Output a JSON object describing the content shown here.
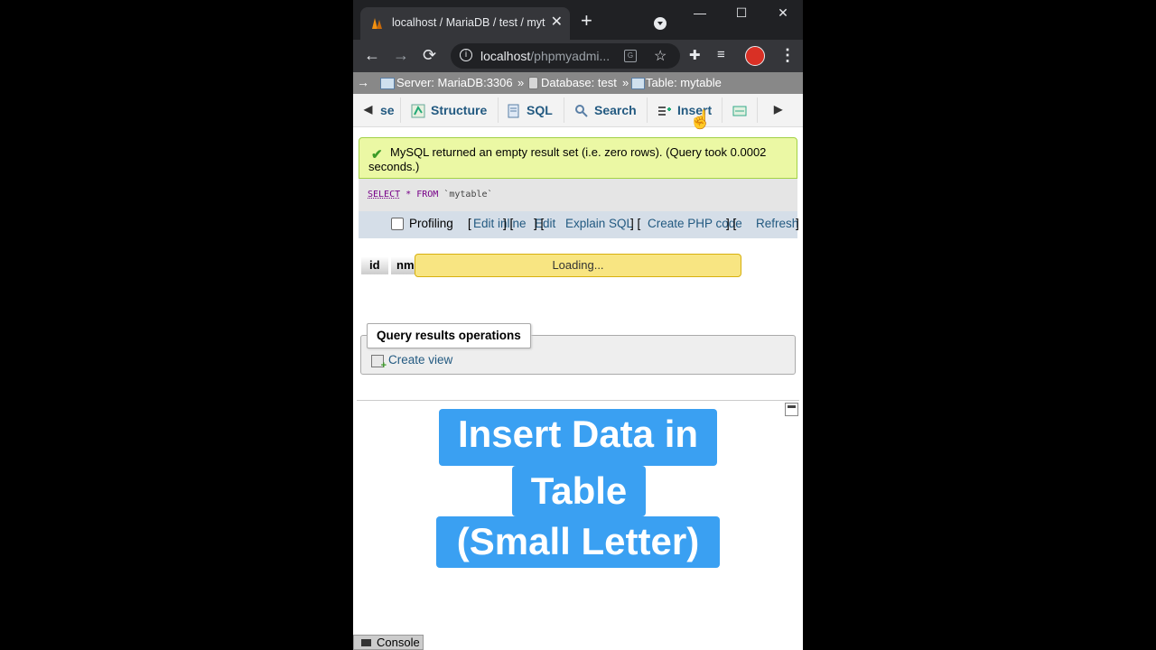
{
  "browser": {
    "tab_title": "localhost / MariaDB / test / myt",
    "tab_close": "✕",
    "new_tab": "+",
    "window": {
      "minimize": "—",
      "maximize": "☐",
      "close": "✕"
    },
    "url_host": "localhost",
    "url_path": "/phpmyadmi...",
    "nav": {
      "back": "←",
      "forward": "→",
      "reload": "⟳"
    },
    "icons": [
      "info-icon",
      "translate-icon",
      "star-icon",
      "extensions-icon",
      "media-icon",
      "profile-avatar",
      "menu-icon"
    ]
  },
  "breadcrumb": {
    "arrow": "→",
    "server": "Server: MariaDB:3306",
    "sep": "»",
    "database": "Database: test",
    "table": "Table: mytable"
  },
  "tabs": [
    {
      "label": "se"
    },
    {
      "label": "Structure"
    },
    {
      "label": "SQL"
    },
    {
      "label": "Search"
    },
    {
      "label": "Insert"
    },
    {
      "label": ""
    }
  ],
  "message": {
    "text": "MySQL returned an empty result set (i.e. zero rows). (Query took 0.0002 seconds.)",
    "sql_keyword": "SELECT",
    "sql_star": "*",
    "sql_from": "FROM",
    "sql_table": "`mytable`"
  },
  "query_links": {
    "profiling": "Profiling",
    "edit_inline": "Edit inline",
    "edit": "Edit",
    "explain": "Explain SQL",
    "php": "Create PHP code",
    "refresh": "Refresh",
    "open": "[",
    "close": "]",
    "between": "] ["
  },
  "results": {
    "columns": [
      "id",
      "nm"
    ],
    "loading": "Loading..."
  },
  "operations": {
    "legend": "Query results operations",
    "create_view": "Create view"
  },
  "caption": [
    "Insert Data in",
    "Table",
    "(Small Letter)"
  ],
  "console": "Console",
  "colors": {
    "caption_bg": "#3aa0f2",
    "success_bg": "#ebf8a4",
    "loading_bg": "#f8e582",
    "link": "#235a81"
  }
}
